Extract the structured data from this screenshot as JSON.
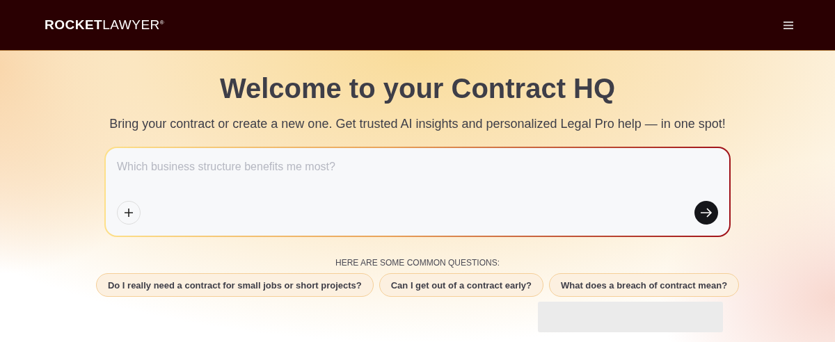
{
  "header": {
    "logo": "**ROCKET**LAWYER$^{®}$"
  },
  "hero": {
    "title": "Welcome to your Contract HQ",
    "subtitle": "Bring your contract or create a new one. Get trusted AI insights and personalized Legal Pro help — in one spot!"
  },
  "prompt": {
    "placeholder": "Which business structure benefits me most?"
  },
  "questions": {
    "heading": "HERE ARE SOME COMMON QUESTIONS:",
    "items": [
      "Do I really need a contract for small jobs or short projects?",
      "Can I get out of a contract early?",
      "What does a breach of contract mean?"
    ]
  }
}
